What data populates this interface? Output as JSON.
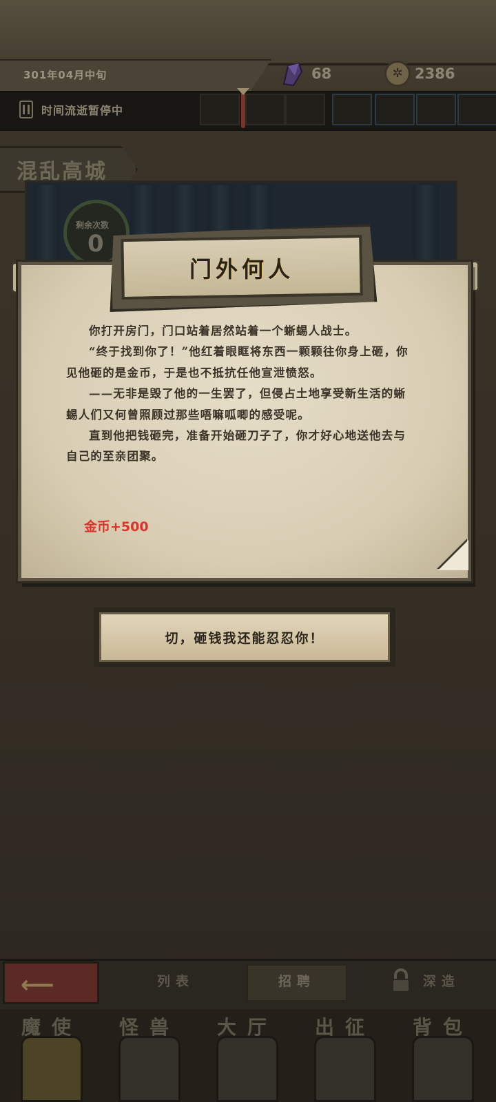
{
  "header": {
    "date": "301年04月中旬",
    "crystal_count": "68",
    "coin_count": "2386",
    "coin_icon": "coin-icon",
    "crystal_icon": "purple-crystal-icon"
  },
  "time_bar": {
    "status": "时间流逝暂停中",
    "pause_icon": "pause-icon"
  },
  "location": {
    "name": "混乱高城",
    "remaining_label": "剩余次数",
    "remaining_count": "0"
  },
  "event": {
    "title": "门外何人",
    "paragraphs": [
      "你打开房门，门口站着居然站着一个蜥蜴人战士。",
      "“终于找到你了！”他红着眼眶将东西一颗颗往你身上砸，你见他砸的是金币，于是也不抵抗任他宣泄愤怒。",
      "——无非是毁了他的一生罢了，但侵占土地享受新生活的蜥蜴人们又何曾照顾过那些唔嘛呱唧的感受呢。",
      "直到他把钱砸完，准备开始砸刀子了，你才好心地送他去与自己的至亲团聚。"
    ],
    "reward": "金币+500",
    "reward_color": "#e0312b",
    "choice_label": "切，砸钱我还能忍忍你！"
  },
  "bottom_tabs": {
    "back_icon": "back-arrow-icon",
    "list": "列表",
    "recruit": "招聘",
    "deep": "深造",
    "lock_icon": "lock-icon"
  },
  "nav": [
    {
      "label": "魔使",
      "icon": "skull-helmet-icon"
    },
    {
      "label": "怪兽",
      "icon": "monster-face-icon"
    },
    {
      "label": "大厅",
      "icon": "hall-icon"
    },
    {
      "label": "出征",
      "icon": "expedition-icon"
    },
    {
      "label": "背包",
      "icon": "backpack-icon"
    }
  ]
}
